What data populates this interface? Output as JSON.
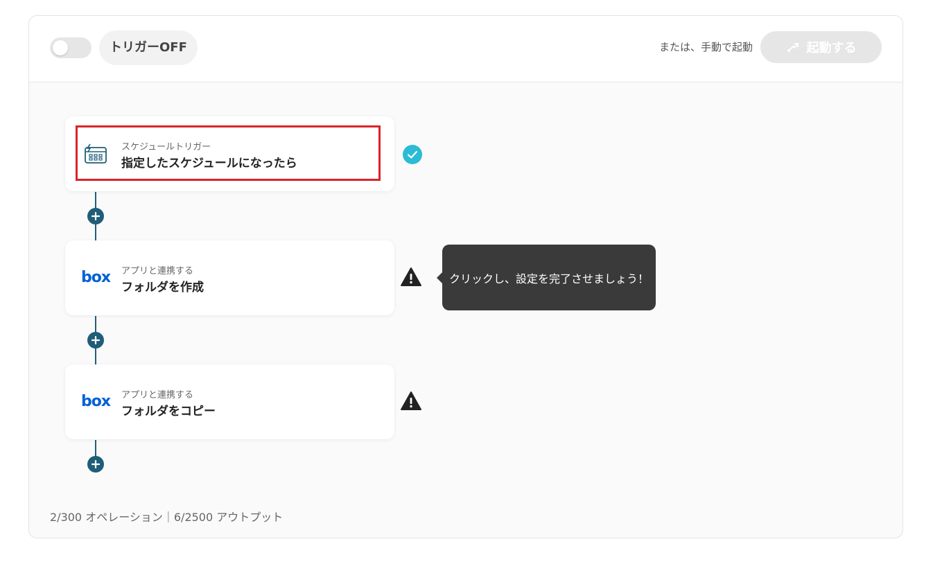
{
  "header": {
    "trigger_status": "トリガーOFF",
    "manual_label": "または、手動で起動",
    "run_label": "起動する"
  },
  "steps": [
    {
      "subtitle": "スケジュールトリガー",
      "title": "指定したスケジュールになったら",
      "icon": "schedule-calendar-icon",
      "status": "complete"
    },
    {
      "subtitle": "アプリと連携する",
      "title": "フォルダを作成",
      "icon": "box-logo",
      "logo_text": "box",
      "status": "warning"
    },
    {
      "subtitle": "アプリと連携する",
      "title": "フォルダをコピー",
      "icon": "box-logo",
      "logo_text": "box",
      "status": "warning"
    }
  ],
  "tooltip": {
    "text": "クリックし、設定を完了させましょう！"
  },
  "footer": {
    "usage": "2/300 オペレーション｜6/2500 アウトプット"
  },
  "colors": {
    "accent": "#1f5e78",
    "check": "#2bbbd4",
    "highlight": "#d9232a",
    "box_blue": "#0061d5"
  }
}
